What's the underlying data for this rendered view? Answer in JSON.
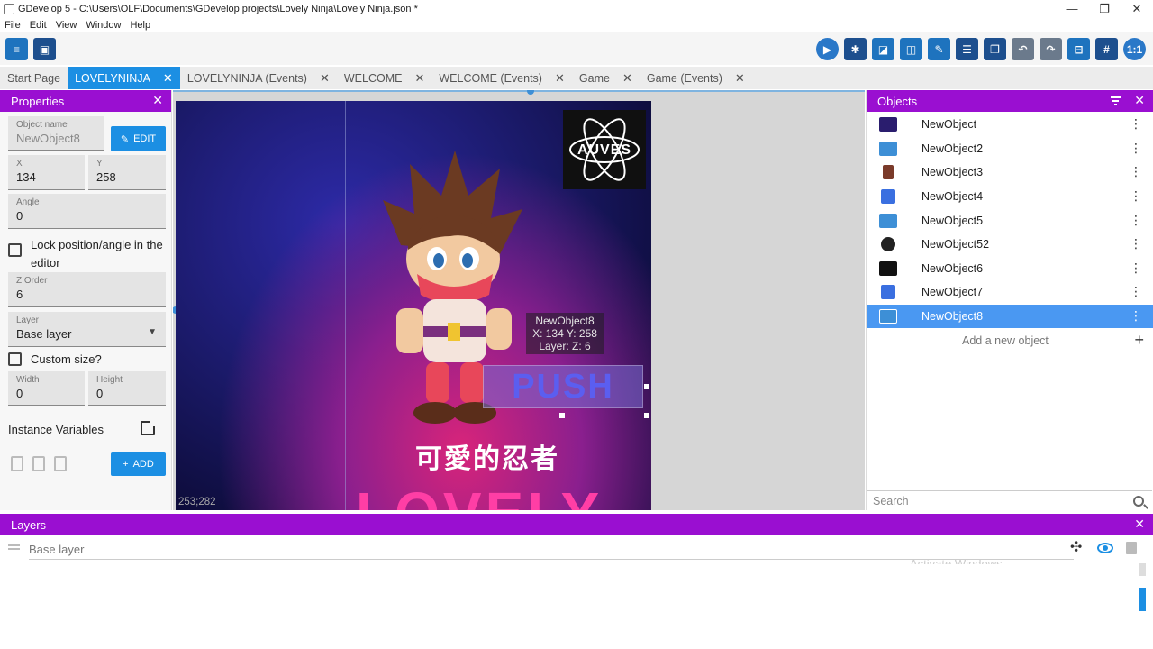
{
  "window": {
    "title": "GDevelop 5 - C:\\Users\\OLF\\Documents\\GDevelop projects\\Lovely Ninja\\Lovely Ninja.json *",
    "minimize": "—",
    "maximize": "❐",
    "close": "✕"
  },
  "menu": [
    "File",
    "Edit",
    "View",
    "Window",
    "Help"
  ],
  "toolbar": {
    "zoom_label": "1:1"
  },
  "tabs": [
    {
      "label": "Start Page",
      "closable": false
    },
    {
      "label": "LOVELYNINJA",
      "closable": true
    },
    {
      "label": "LOVELYNINJA (Events)",
      "closable": true
    },
    {
      "label": "WELCOME",
      "closable": true
    },
    {
      "label": "WELCOME (Events)",
      "closable": true
    },
    {
      "label": "Game",
      "closable": true
    },
    {
      "label": "Game (Events)",
      "closable": true
    }
  ],
  "tab_close": "✕",
  "properties": {
    "header": "Properties",
    "close": "✕",
    "object_name_label": "Object name",
    "object_name": "NewObject8",
    "edit_label": "EDIT",
    "x_label": "X",
    "x": "134",
    "y_label": "Y",
    "y": "258",
    "angle_label": "Angle",
    "angle": "0",
    "lock_label": "Lock position/angle in the editor",
    "zorder_label": "Z Order",
    "zorder": "6",
    "layer_label": "Layer",
    "layer": "Base layer",
    "custom_size_label": "Custom size?",
    "width_label": "Width",
    "width": "0",
    "height_label": "Height",
    "height": "0",
    "instance_vars_label": "Instance Variables",
    "add_label": "ADD"
  },
  "scene": {
    "logo_text": "AUVES",
    "push_text": "PUSH",
    "tooltip_name": "NewObject8",
    "tooltip_pos": "X: 134  Y: 258",
    "tooltip_layer": "Layer:   Z: 6",
    "cn_title": "可愛的忍者",
    "lovely_text": "LOVELY",
    "coords": "253;282"
  },
  "objects": {
    "header": "Objects",
    "close": "✕",
    "items": [
      {
        "name": "NewObject",
        "thumb": "#2a1d6e"
      },
      {
        "name": "NewObject2",
        "thumb": "#3d8fd6"
      },
      {
        "name": "NewObject3",
        "thumb": "#7a3a2a"
      },
      {
        "name": "NewObject4",
        "thumb": "#3a6fe0"
      },
      {
        "name": "NewObject5",
        "thumb": "#3d8fd6"
      },
      {
        "name": "NewObject52",
        "thumb": "#222222"
      },
      {
        "name": "NewObject6",
        "thumb": "#111111"
      },
      {
        "name": "NewObject7",
        "thumb": "#3a6fe0"
      },
      {
        "name": "NewObject8",
        "thumb": "#3d8fd6"
      }
    ],
    "menu_glyph": "⋮",
    "add_new": "Add a new object",
    "add_plus": "+",
    "search_placeholder": "Search"
  },
  "layers": {
    "header": "Layers",
    "close": "✕",
    "items": [
      {
        "name": "Base layer"
      }
    ],
    "target_glyph": "✣"
  },
  "watermark": "Activate Windows",
  "colors": {
    "accent": "#1c8fe3",
    "panel_header": "#9a0fd1",
    "selected_row": "#4a98f2"
  }
}
